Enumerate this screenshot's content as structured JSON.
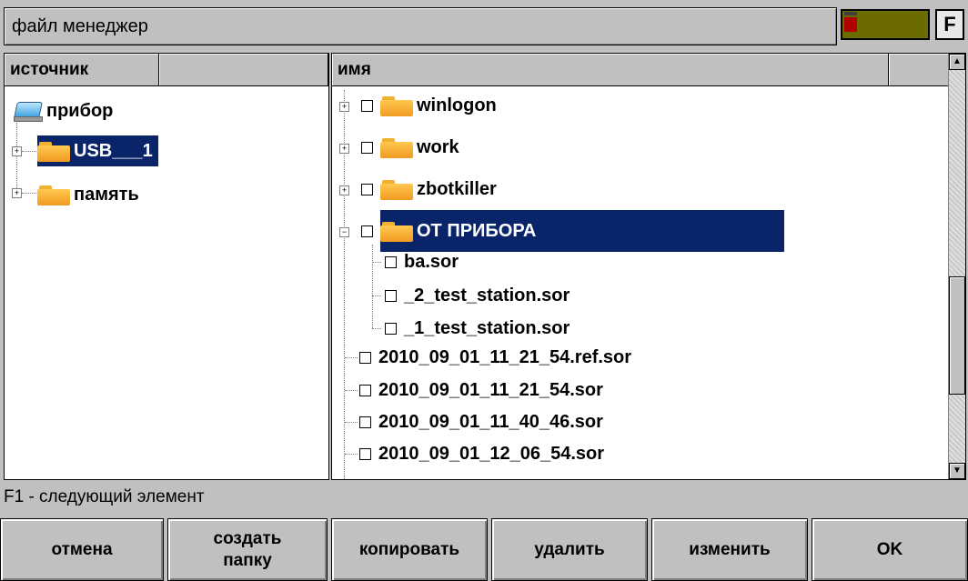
{
  "window": {
    "title": "файл менеджер",
    "fkey": "F"
  },
  "left": {
    "header_col1": "источник",
    "items": [
      {
        "label": "прибор"
      },
      {
        "label": "USB___1"
      },
      {
        "label": "память"
      }
    ]
  },
  "right": {
    "header_col1": "имя",
    "items": [
      {
        "label": "winlogon"
      },
      {
        "label": "work"
      },
      {
        "label": "zbotkiller"
      },
      {
        "label": "ОТ ПРИБОРА"
      },
      {
        "label": "ba.sor"
      },
      {
        "label": "_2_test_station.sor"
      },
      {
        "label": "_1_test_station.sor"
      },
      {
        "label": "2010_09_01_11_21_54.ref.sor"
      },
      {
        "label": "2010_09_01_11_21_54.sor"
      },
      {
        "label": "2010_09_01_11_40_46.sor"
      },
      {
        "label": "2010_09_01_12_06_54.sor"
      }
    ]
  },
  "status": "F1 - следующий элемент",
  "buttons": [
    {
      "label": "отмена"
    },
    {
      "label": "создать\nпапку"
    },
    {
      "label": "копировать"
    },
    {
      "label": "удалить"
    },
    {
      "label": "изменить"
    },
    {
      "label": "OK"
    }
  ],
  "colors": {
    "selection": "#0a246a",
    "folder": "#f0b030",
    "background": "#c0c0c0"
  }
}
